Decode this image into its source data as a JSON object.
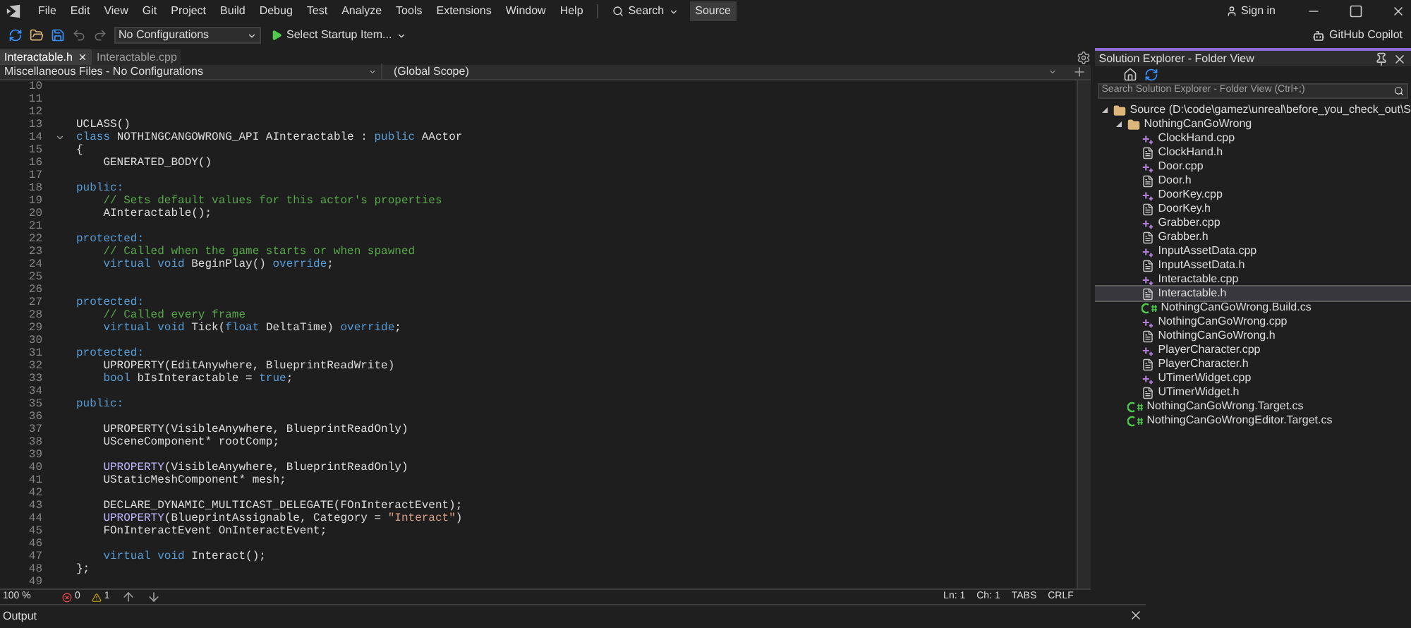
{
  "menu": [
    "File",
    "Edit",
    "View",
    "Git",
    "Project",
    "Build",
    "Debug",
    "Test",
    "Analyze",
    "Tools",
    "Extensions",
    "Window",
    "Help"
  ],
  "search": "Search",
  "solution_badge": "Source",
  "sign_in": "Sign in",
  "copilot": "GitHub Copilot",
  "toolbar": {
    "configuration": "No Configurations",
    "startup": "Select Startup Item..."
  },
  "tabs": [
    {
      "label": "Interactable.h",
      "selected": true
    },
    {
      "label": "Interactable.cpp",
      "selected": false
    }
  ],
  "nav": {
    "project": "Miscellaneous Files - No Configurations",
    "scope": "(Global Scope)"
  },
  "code": [
    {
      "number": "10",
      "expanded": false
    },
    {
      "number": "11",
      "expanded": false
    },
    {
      "number": "12",
      "expanded": false
    },
    {
      "number": "13",
      "expanded": false,
      "tokens": [
        {
          "text": "UCLASS()",
          "kind": "plain"
        }
      ]
    },
    {
      "number": "14",
      "expanded": true,
      "tokens": [
        {
          "text": "class",
          "kind": "keyword"
        },
        {
          "text": " NOTHINGCANGOWRONG_API AInteractable : ",
          "kind": "plain"
        },
        {
          "text": "public",
          "kind": "keyword"
        },
        {
          "text": " AActor",
          "kind": "plain"
        }
      ]
    },
    {
      "number": "15",
      "expanded": false,
      "tokens": [
        {
          "text": "{",
          "kind": "plain"
        }
      ]
    },
    {
      "number": "16",
      "expanded": false,
      "tokens": [
        {
          "text": "    GENERATED_BODY()",
          "kind": "plain"
        }
      ]
    },
    {
      "number": "17",
      "expanded": false
    },
    {
      "number": "18",
      "expanded": false,
      "tokens": [
        {
          "text": "public:",
          "kind": "keyword"
        }
      ]
    },
    {
      "number": "19",
      "expanded": false,
      "tokens": [
        {
          "text": "    // Sets default values for this actor's properties",
          "kind": "comment"
        }
      ]
    },
    {
      "number": "20",
      "expanded": false,
      "tokens": [
        {
          "text": "    AInteractable();",
          "kind": "plain"
        }
      ]
    },
    {
      "number": "21",
      "expanded": false
    },
    {
      "number": "22",
      "expanded": false,
      "tokens": [
        {
          "text": "protected:",
          "kind": "keyword"
        }
      ]
    },
    {
      "number": "23",
      "expanded": false,
      "tokens": [
        {
          "text": "    // Called when the game starts or when spawned",
          "kind": "comment"
        }
      ]
    },
    {
      "number": "24",
      "expanded": false,
      "tokens": [
        {
          "text": "    virtual void",
          "kind": "keyword"
        },
        {
          "text": " BeginPlay() ",
          "kind": "plain"
        },
        {
          "text": "override",
          "kind": "keyword"
        },
        {
          "text": ";",
          "kind": "plain"
        }
      ]
    },
    {
      "number": "25",
      "expanded": false
    },
    {
      "number": "26",
      "expanded": false
    },
    {
      "number": "27",
      "expanded": false,
      "tokens": [
        {
          "text": "protected:",
          "kind": "keyword"
        }
      ]
    },
    {
      "number": "28",
      "expanded": false,
      "tokens": [
        {
          "text": "    // Called every frame",
          "kind": "comment"
        }
      ]
    },
    {
      "number": "29",
      "expanded": false,
      "tokens": [
        {
          "text": "    virtual void",
          "kind": "keyword"
        },
        {
          "text": " Tick(",
          "kind": "plain"
        },
        {
          "text": "float",
          "kind": "keyword"
        },
        {
          "text": " DeltaTime) ",
          "kind": "plain"
        },
        {
          "text": "override",
          "kind": "keyword"
        },
        {
          "text": ";",
          "kind": "plain"
        }
      ]
    },
    {
      "number": "30",
      "expanded": false
    },
    {
      "number": "31",
      "expanded": false,
      "tokens": [
        {
          "text": "protected:",
          "kind": "keyword"
        }
      ]
    },
    {
      "number": "32",
      "expanded": false,
      "tokens": [
        {
          "text": "    UPROPERTY(EditAnywhere, BlueprintReadWrite)",
          "kind": "plain"
        }
      ]
    },
    {
      "number": "33",
      "expanded": false,
      "tokens": [
        {
          "text": "    bool",
          "kind": "keyword"
        },
        {
          "text": " bIsInteractable = ",
          "kind": "plain"
        },
        {
          "text": "true",
          "kind": "keyword"
        },
        {
          "text": ";",
          "kind": "plain"
        }
      ]
    },
    {
      "number": "34",
      "expanded": false
    },
    {
      "number": "35",
      "expanded": false,
      "tokens": [
        {
          "text": "public:",
          "kind": "keyword"
        }
      ]
    },
    {
      "number": "36",
      "expanded": false
    },
    {
      "number": "37",
      "expanded": false,
      "tokens": [
        {
          "text": "    UPROPERTY(VisibleAnywhere, BlueprintReadOnly)",
          "kind": "plain"
        }
      ]
    },
    {
      "number": "38",
      "expanded": false,
      "tokens": [
        {
          "text": "    USceneComponent* rootComp;",
          "kind": "plain"
        }
      ]
    },
    {
      "number": "39",
      "expanded": false
    },
    {
      "number": "40",
      "expanded": false,
      "tokens": [
        {
          "text": "    UPROPERTY",
          "kind": "macro"
        },
        {
          "text": "(VisibleAnywhere, BlueprintReadOnly)",
          "kind": "plain"
        }
      ]
    },
    {
      "number": "41",
      "expanded": false,
      "tokens": [
        {
          "text": "    UStaticMeshComponent* mesh;",
          "kind": "plain"
        }
      ]
    },
    {
      "number": "42",
      "expanded": false
    },
    {
      "number": "43",
      "expanded": false,
      "tokens": [
        {
          "text": "    DECLARE_DYNAMIC_MULTICAST_DELEGATE(FOnInteractEvent);",
          "kind": "plain"
        }
      ]
    },
    {
      "number": "44",
      "expanded": false,
      "tokens": [
        {
          "text": "    UPROPERTY",
          "kind": "macro"
        },
        {
          "text": "(BlueprintAssignable, Category = ",
          "kind": "plain"
        },
        {
          "text": "\"Interact\"",
          "kind": "string"
        },
        {
          "text": ")",
          "kind": "plain"
        }
      ]
    },
    {
      "number": "45",
      "expanded": false,
      "tokens": [
        {
          "text": "    FOnInteractEvent OnInteractEvent;",
          "kind": "plain"
        }
      ]
    },
    {
      "number": "46",
      "expanded": false
    },
    {
      "number": "47",
      "expanded": false,
      "tokens": [
        {
          "text": "    virtual void",
          "kind": "keyword"
        },
        {
          "text": " Interact();",
          "kind": "plain"
        }
      ]
    },
    {
      "number": "48",
      "expanded": false,
      "tokens": [
        {
          "text": "};",
          "kind": "plain"
        }
      ]
    },
    {
      "number": "49",
      "expanded": false
    }
  ],
  "status_bar": {
    "zoom": "100 %",
    "errors": "0",
    "warnings": "1",
    "line": "Ln: 1",
    "column": "Ch: 1",
    "indent": "TABS",
    "line_ending": "CRLF"
  },
  "output": {
    "title": "Output"
  },
  "solution_explorer": {
    "title": "Solution Explorer - Folder View",
    "search_placeholder": "Search Solution Explorer - Folder View (Ctrl+;)",
    "tree": [
      {
        "label": "Source (D:\\code\\gamez\\unreal\\before_you_check_out\\S",
        "kind": "folder",
        "expanded": true,
        "selected": false,
        "children": [
          {
            "label": "NothingCanGoWrong",
            "kind": "folder",
            "expanded": true,
            "selected": false,
            "children": [
              {
                "label": "ClockHand.cpp",
                "kind": "cpp",
                "selected": false
              },
              {
                "label": "ClockHand.h",
                "kind": "h",
                "selected": false
              },
              {
                "label": "Door.cpp",
                "kind": "cpp",
                "selected": false
              },
              {
                "label": "Door.h",
                "kind": "h",
                "selected": false
              },
              {
                "label": "DoorKey.cpp",
                "kind": "cpp",
                "selected": false
              },
              {
                "label": "DoorKey.h",
                "kind": "h",
                "selected": false
              },
              {
                "label": "Grabber.cpp",
                "kind": "cpp",
                "selected": false
              },
              {
                "label": "Grabber.h",
                "kind": "h",
                "selected": false
              },
              {
                "label": "InputAssetData.cpp",
                "kind": "cpp",
                "selected": false
              },
              {
                "label": "InputAssetData.h",
                "kind": "h",
                "selected": false
              },
              {
                "label": "Interactable.cpp",
                "kind": "cpp",
                "selected": false
              },
              {
                "label": "Interactable.h",
                "kind": "h",
                "selected": true
              },
              {
                "label": "NothingCanGoWrong.Build.cs",
                "kind": "cs",
                "selected": false
              },
              {
                "label": "NothingCanGoWrong.cpp",
                "kind": "cpp",
                "selected": false
              },
              {
                "label": "NothingCanGoWrong.h",
                "kind": "h",
                "selected": false
              },
              {
                "label": "PlayerCharacter.cpp",
                "kind": "cpp",
                "selected": false
              },
              {
                "label": "PlayerCharacter.h",
                "kind": "h",
                "selected": false
              },
              {
                "label": "UTimerWidget.cpp",
                "kind": "cpp",
                "selected": false
              },
              {
                "label": "UTimerWidget.h",
                "kind": "h",
                "selected": false
              }
            ]
          },
          {
            "label": "NothingCanGoWrong.Target.cs",
            "kind": "cs",
            "selected": false
          },
          {
            "label": "NothingCanGoWrongEditor.Target.cs",
            "kind": "cs",
            "selected": false
          }
        ]
      }
    ]
  }
}
